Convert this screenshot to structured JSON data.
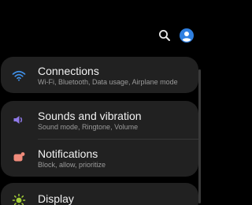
{
  "header": {
    "search_icon": "search-icon",
    "account_icon": "account-icon"
  },
  "settings": [
    {
      "title": "Connections",
      "subtitle": "Wi-Fi, Bluetooth, Data usage, Airplane mode",
      "icon": "wifi-icon",
      "icon_color": "#3f8fe6"
    },
    {
      "title": "Sounds and vibration",
      "subtitle": "Sound mode, Ringtone, Volume",
      "icon": "speaker-icon",
      "icon_color": "#8f79e8"
    },
    {
      "title": "Notifications",
      "subtitle": "Block, allow, prioritize",
      "icon": "notifications-icon",
      "icon_color": "#f08b7b"
    },
    {
      "title": "Display",
      "subtitle": "",
      "icon": "brightness-icon",
      "icon_color": "#a3cf38"
    }
  ],
  "colors": {
    "background": "#000000",
    "card": "#212121",
    "title_text": "#f2f2f2",
    "subtitle_text": "#9b9b9b",
    "accent": "#2f7fe0"
  }
}
